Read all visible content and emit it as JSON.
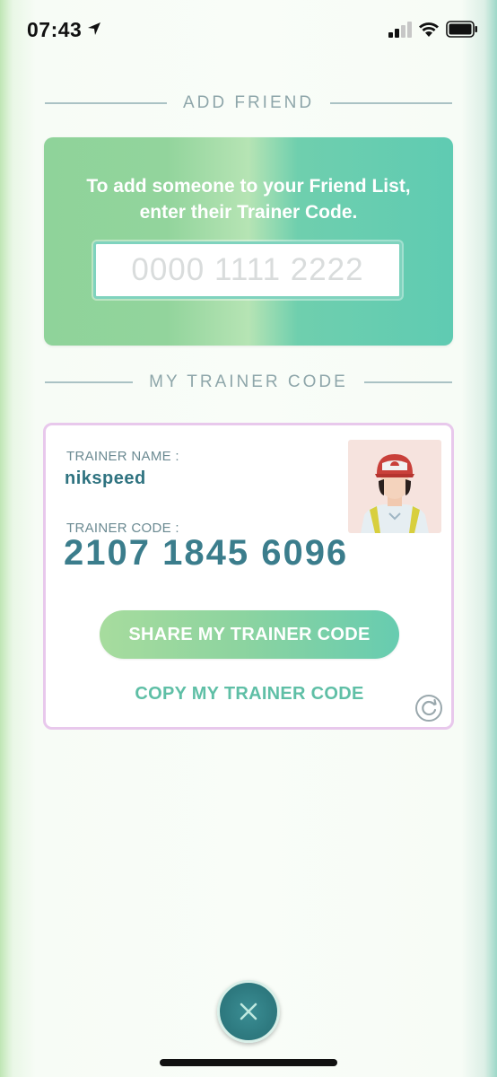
{
  "status_bar": {
    "time": "07:43",
    "icons": [
      "location-arrow-icon",
      "signal-icon",
      "wifi-icon",
      "battery-icon"
    ]
  },
  "add_friend": {
    "header": "ADD FRIEND",
    "instruction": "To add someone to your Friend List, enter their Trainer Code.",
    "input": {
      "value": "",
      "placeholder": "0000 1111 2222"
    }
  },
  "my_trainer_code": {
    "header": "MY TRAINER CODE",
    "name_label": "TRAINER NAME :",
    "name": "nikspeed",
    "code_label": "TRAINER CODE :",
    "code": "2107 1845 6096",
    "share_label": "SHARE MY TRAINER CODE",
    "copy_label": "COPY MY TRAINER CODE"
  },
  "icons": {
    "refresh": "refresh-icon",
    "close": "close-icon",
    "avatar": "trainer-avatar"
  },
  "colors": {
    "accent_green": "#8ed49f",
    "accent_teal": "#5fcbb2",
    "code_text": "#3b7d8c",
    "card_border": "#e8c8ec",
    "close_button": "#2e7a80"
  }
}
